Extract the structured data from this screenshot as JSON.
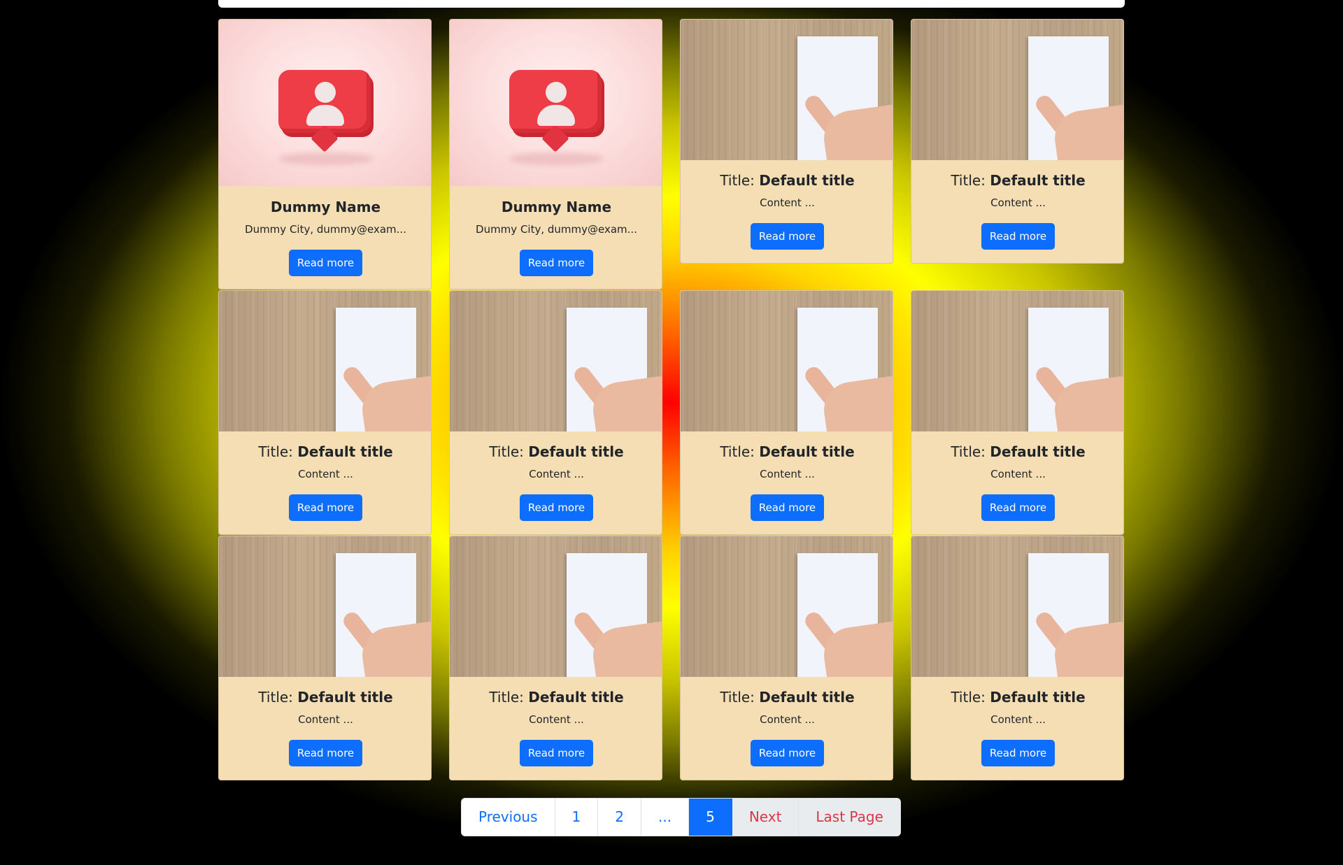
{
  "profile_cards": [
    {
      "name": "Dummy Name",
      "info": "Dummy City, dummy@exam...",
      "button": "Read more"
    },
    {
      "name": "Dummy Name",
      "info": "Dummy City, dummy@exam...",
      "button": "Read more"
    }
  ],
  "post_cards": [
    {
      "title_prefix": "Title: ",
      "title": "Default title",
      "content": "Content ...",
      "button": "Read more"
    },
    {
      "title_prefix": "Title: ",
      "title": "Default title",
      "content": "Content ...",
      "button": "Read more"
    },
    {
      "title_prefix": "Title: ",
      "title": "Default title",
      "content": "Content ...",
      "button": "Read more"
    },
    {
      "title_prefix": "Title: ",
      "title": "Default title",
      "content": "Content ...",
      "button": "Read more"
    },
    {
      "title_prefix": "Title: ",
      "title": "Default title",
      "content": "Content ...",
      "button": "Read more"
    },
    {
      "title_prefix": "Title: ",
      "title": "Default title",
      "content": "Content ...",
      "button": "Read more"
    },
    {
      "title_prefix": "Title: ",
      "title": "Default title",
      "content": "Content ...",
      "button": "Read more"
    },
    {
      "title_prefix": "Title: ",
      "title": "Default title",
      "content": "Content ...",
      "button": "Read more"
    },
    {
      "title_prefix": "Title: ",
      "title": "Default title",
      "content": "Content ...",
      "button": "Read more"
    },
    {
      "title_prefix": "Title: ",
      "title": "Default title",
      "content": "Content ...",
      "button": "Read more"
    }
  ],
  "pagination": {
    "previous": "Previous",
    "pages": [
      "1",
      "2",
      "...",
      "5"
    ],
    "active_page": "5",
    "next": "Next",
    "last": "Last Page"
  },
  "colors": {
    "card_bg": "#f5deb3",
    "button": "#0d6efd",
    "next_text": "#dc3545"
  },
  "icons": {
    "profile": "user-bubble-icon",
    "post": "chart-report-image"
  }
}
